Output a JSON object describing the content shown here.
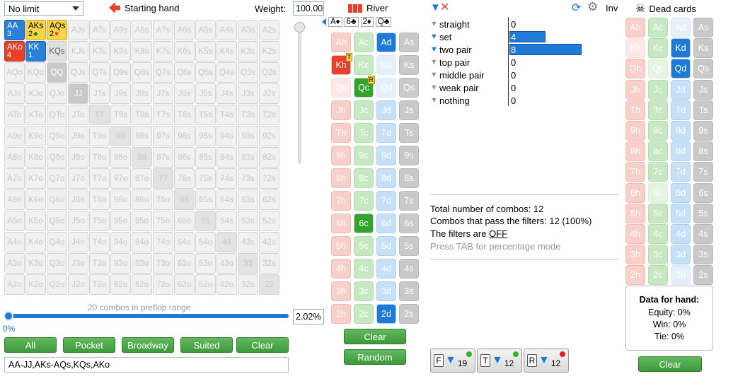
{
  "range": {
    "limit": "No limit",
    "starting_hand": "Starting hand",
    "weight_label": "Weight:",
    "weight_value": "100.00",
    "combos_text": "20 combos in preflop range",
    "slider_pct": "0%",
    "slider_value": "2.02%",
    "range_text": "AA-JJ,AKs-AQs,KQs,AKo",
    "buttons": [
      "All",
      "Pocket",
      "Broadway",
      "Suited",
      "Clear"
    ],
    "rows": [
      [
        "AA",
        "AKs",
        "AQs",
        "AJs",
        "ATs",
        "A9s",
        "A8s",
        "A7s",
        "A6s",
        "A5s",
        "A4s",
        "A3s",
        "A2s"
      ],
      [
        "AKo",
        "KK",
        "KQs",
        "KJs",
        "KTs",
        "K9s",
        "K8s",
        "K7s",
        "K6s",
        "K5s",
        "K4s",
        "K3s",
        "K2s"
      ],
      [
        "AQo",
        "KQo",
        "QQ",
        "QJs",
        "QTs",
        "Q9s",
        "Q8s",
        "Q7s",
        "Q6s",
        "Q5s",
        "Q4s",
        "Q3s",
        "Q2s"
      ],
      [
        "AJo",
        "KJo",
        "QJo",
        "JJ",
        "JTs",
        "J9s",
        "J8s",
        "J7s",
        "J6s",
        "J5s",
        "J4s",
        "J3s",
        "J2s"
      ],
      [
        "ATo",
        "KTo",
        "QTo",
        "JTo",
        "TT",
        "T9s",
        "T8s",
        "T7s",
        "T6s",
        "T5s",
        "T4s",
        "T3s",
        "T2s"
      ],
      [
        "A9o",
        "K9o",
        "Q9o",
        "J9o",
        "T9o",
        "99",
        "98s",
        "97s",
        "96s",
        "95s",
        "94s",
        "93s",
        "92s"
      ],
      [
        "A8o",
        "K8o",
        "Q8o",
        "J8o",
        "T8o",
        "98o",
        "88",
        "87s",
        "86s",
        "85s",
        "84s",
        "83s",
        "82s"
      ],
      [
        "A7o",
        "K7o",
        "Q7o",
        "J7o",
        "T7o",
        "97o",
        "87o",
        "77",
        "76s",
        "75s",
        "74s",
        "73s",
        "72s"
      ],
      [
        "A6o",
        "K6o",
        "Q6o",
        "J6o",
        "T6o",
        "96o",
        "86o",
        "76o",
        "66",
        "65s",
        "64s",
        "63s",
        "62s"
      ],
      [
        "A5o",
        "K5o",
        "Q5o",
        "J5o",
        "T5o",
        "95o",
        "85o",
        "75o",
        "65o",
        "55",
        "54s",
        "53s",
        "52s"
      ],
      [
        "A4o",
        "K4o",
        "Q4o",
        "J4o",
        "T4o",
        "94o",
        "84o",
        "74o",
        "64o",
        "54o",
        "44",
        "43s",
        "42s"
      ],
      [
        "A3o",
        "K3o",
        "Q3o",
        "J3o",
        "T3o",
        "93o",
        "83o",
        "73o",
        "63o",
        "53o",
        "43o",
        "33",
        "32s"
      ],
      [
        "A2o",
        "K2o",
        "Q2o",
        "J2o",
        "T2o",
        "92o",
        "82o",
        "72o",
        "62o",
        "52o",
        "42o",
        "32o",
        "22"
      ]
    ],
    "selected": {
      "AA": {
        "style": "bsel",
        "count": "3"
      },
      "AKs": {
        "style": "ysel",
        "count": "2",
        "suit": "♣"
      },
      "AQs": {
        "style": "ysel",
        "count": "2",
        "suit": "♥"
      },
      "AKo": {
        "style": "rsel",
        "count": "4"
      },
      "KK": {
        "style": "bsel",
        "count": "1"
      },
      "KQs": {
        "style": "gray",
        "count": ""
      },
      "QQ": {
        "style": "dark",
        "count": ""
      },
      "JJ": {
        "style": "dark",
        "count": ""
      }
    }
  },
  "board": {
    "title": "River",
    "board_cards": [
      "A♦",
      "6♣",
      "2♦",
      "Q♣"
    ],
    "ranks": [
      "A",
      "K",
      "Q",
      "J",
      "T",
      "9",
      "8",
      "7",
      "6",
      "5",
      "4",
      "3",
      "2"
    ],
    "selected": [
      "Ad",
      "Kh",
      "Qc",
      "6c",
      "2d"
    ],
    "tags": {
      "Kh": "T",
      "Qc": "R"
    },
    "faint": [
      "Kd",
      "Qd",
      "Qh"
    ],
    "clear_label": "Clear",
    "random_label": "Random"
  },
  "filters": {
    "rows": [
      {
        "label": "straight",
        "value": "0",
        "frac": 0
      },
      {
        "label": "set",
        "value": "4",
        "frac": 0.5
      },
      {
        "label": "two pair",
        "value": "8",
        "frac": 1.0
      },
      {
        "label": "top pair",
        "value": "0",
        "frac": 0
      },
      {
        "label": "middle pair",
        "value": "0",
        "frac": 0
      },
      {
        "label": "weak pair",
        "value": "0",
        "frac": 0
      },
      {
        "label": "nothing",
        "value": "0",
        "frac": 0
      }
    ],
    "inv": "Inv",
    "total": "Total number of combos: 12",
    "pass": "Combos that pass the filters: 12 (100%)",
    "filters_are": "The filters are",
    "filters_state": "OFF",
    "tab_hint": "Press TAB for percentage mode",
    "tabs": [
      {
        "letter": "F",
        "count": "19",
        "dot": "#2fb52a"
      },
      {
        "letter": "T",
        "count": "12",
        "dot": "#2fb52a"
      },
      {
        "letter": "R",
        "count": "12",
        "dot": "#e02020"
      }
    ]
  },
  "dead": {
    "title": "Dead cards",
    "selected": [
      "Kd",
      "Qd"
    ],
    "faint": [
      "Ad",
      "Kh",
      "Qc",
      "6c",
      "2d"
    ],
    "data_title": "Data for hand:",
    "equity": "Equity: 0%",
    "win": "Win: 0%",
    "tie": "Tie: 0%",
    "clear_label": "Clear"
  }
}
